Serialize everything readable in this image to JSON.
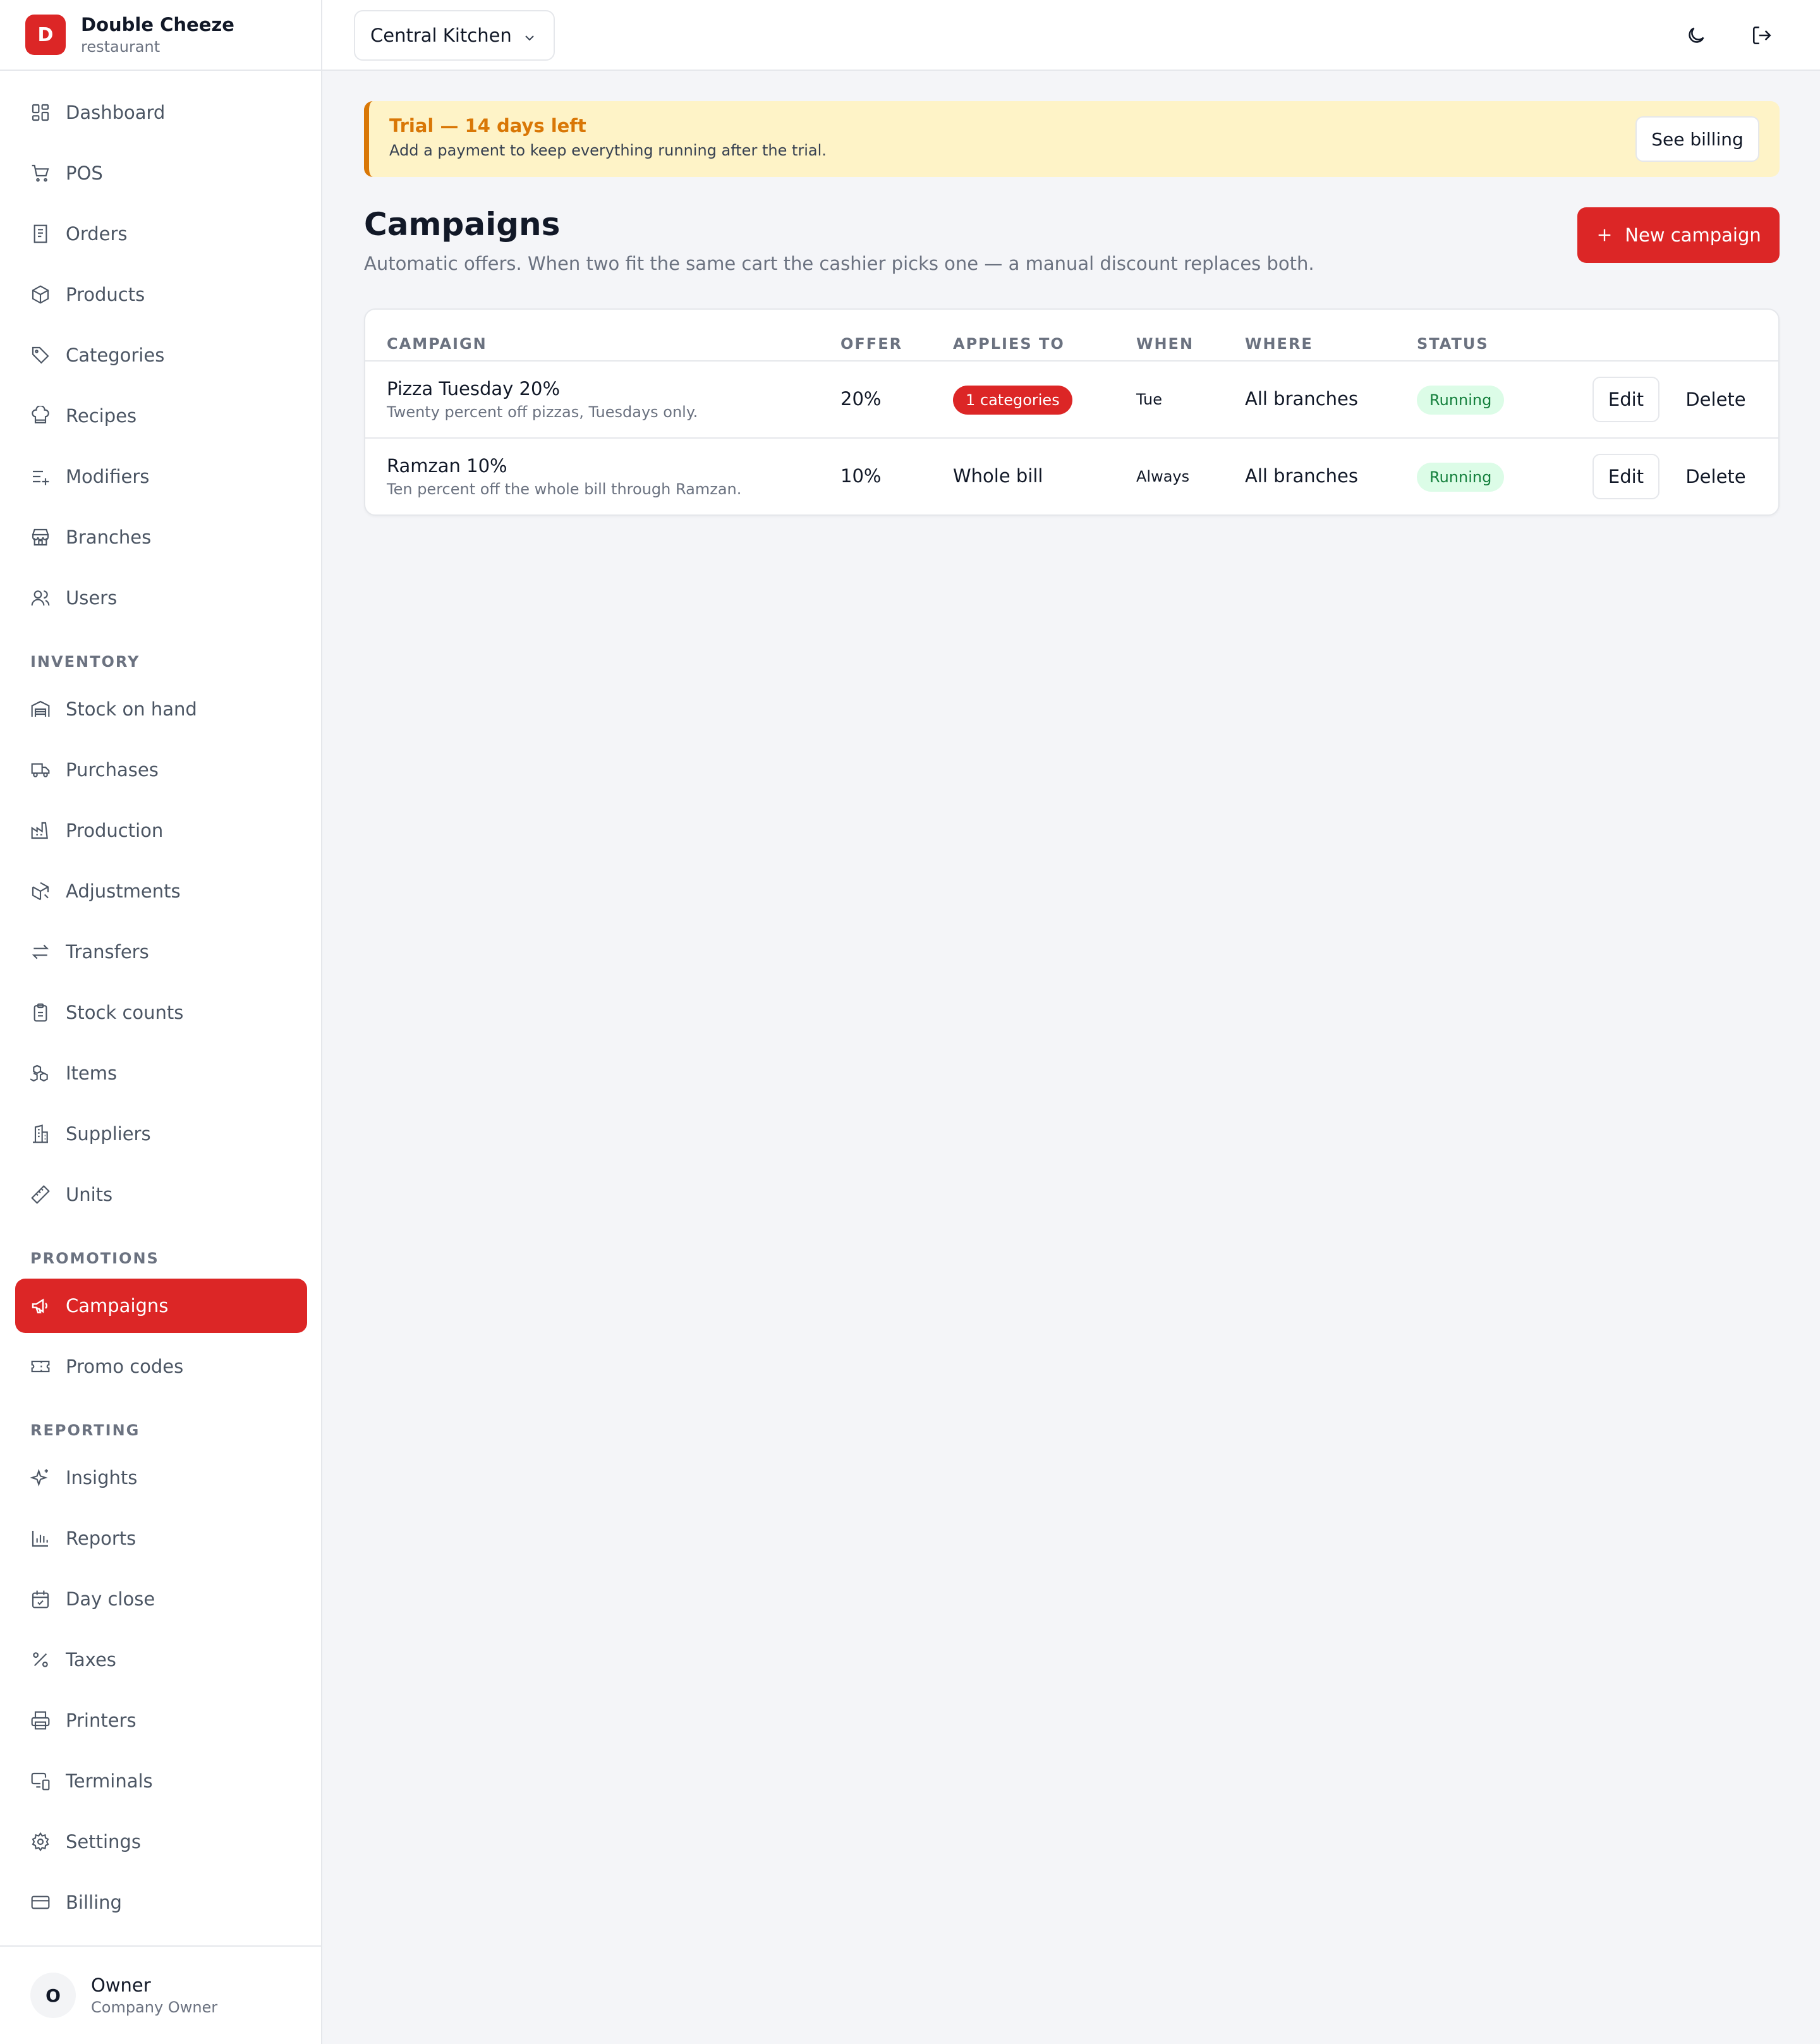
{
  "brand": {
    "initial": "D",
    "name": "Double Cheeze",
    "subtitle": "restaurant"
  },
  "sidebar": {
    "main_items": [
      {
        "label": "Dashboard",
        "icon": "dashboard-icon"
      },
      {
        "label": "POS",
        "icon": "cart-icon"
      },
      {
        "label": "Orders",
        "icon": "receipt-icon"
      },
      {
        "label": "Products",
        "icon": "package-icon"
      },
      {
        "label": "Categories",
        "icon": "tag-icon"
      },
      {
        "label": "Recipes",
        "icon": "chef-hat-icon"
      },
      {
        "label": "Modifiers",
        "icon": "list-plus-icon"
      },
      {
        "label": "Branches",
        "icon": "store-icon"
      },
      {
        "label": "Users",
        "icon": "users-icon"
      }
    ],
    "inventory_label": "INVENTORY",
    "inventory_items": [
      {
        "label": "Stock on hand",
        "icon": "warehouse-icon"
      },
      {
        "label": "Purchases",
        "icon": "truck-icon"
      },
      {
        "label": "Production",
        "icon": "factory-icon"
      },
      {
        "label": "Adjustments",
        "icon": "package-edit-icon"
      },
      {
        "label": "Transfers",
        "icon": "arrows-transfer-icon"
      },
      {
        "label": "Stock counts",
        "icon": "clipboard-icon"
      },
      {
        "label": "Items",
        "icon": "boxes-icon"
      },
      {
        "label": "Suppliers",
        "icon": "building-icon"
      },
      {
        "label": "Units",
        "icon": "ruler-icon"
      }
    ],
    "promotions_label": "PROMOTIONS",
    "promotions_items": [
      {
        "label": "Campaigns",
        "icon": "megaphone-icon",
        "active": true
      },
      {
        "label": "Promo codes",
        "icon": "ticket-icon"
      }
    ],
    "reporting_label": "REPORTING",
    "reporting_items": [
      {
        "label": "Insights",
        "icon": "sparkles-icon"
      },
      {
        "label": "Reports",
        "icon": "bar-chart-icon"
      },
      {
        "label": "Day close",
        "icon": "calendar-check-icon"
      },
      {
        "label": "Taxes",
        "icon": "percent-icon"
      },
      {
        "label": "Printers",
        "icon": "printer-icon"
      },
      {
        "label": "Terminals",
        "icon": "monitor-smartphone-icon"
      },
      {
        "label": "Settings",
        "icon": "gear-icon"
      },
      {
        "label": "Billing",
        "icon": "credit-card-icon"
      }
    ],
    "user": {
      "initial": "O",
      "name": "Owner",
      "role": "Company Owner"
    }
  },
  "topbar": {
    "branch": "Central Kitchen"
  },
  "trial": {
    "title": "Trial — 14 days left",
    "subtitle": "Add a payment to keep everything running after the trial.",
    "button": "See billing"
  },
  "page": {
    "title": "Campaigns",
    "subtitle": "Automatic offers. When two fit the same cart the cashier picks one — a manual discount replaces both.",
    "new_button": "New campaign"
  },
  "table": {
    "headers": [
      "CAMPAIGN",
      "OFFER",
      "APPLIES TO",
      "WHEN",
      "WHERE",
      "STATUS"
    ],
    "rows": [
      {
        "name": "Pizza Tuesday 20%",
        "description": "Twenty percent off pizzas, Tuesdays only.",
        "offer": "20%",
        "applies_to": "1 categories",
        "applies_to_pill": true,
        "when": "Tue",
        "where": "All branches",
        "status": "Running",
        "edit": "Edit",
        "delete": "Delete"
      },
      {
        "name": "Ramzan 10%",
        "description": "Ten percent off the whole bill through Ramzan.",
        "offer": "10%",
        "applies_to": "Whole bill",
        "applies_to_pill": false,
        "when": "Always",
        "where": "All branches",
        "status": "Running",
        "edit": "Edit",
        "delete": "Delete"
      }
    ]
  },
  "colors": {
    "accent": "#dc2626",
    "warning": "#d97706",
    "success": "#15803d"
  }
}
